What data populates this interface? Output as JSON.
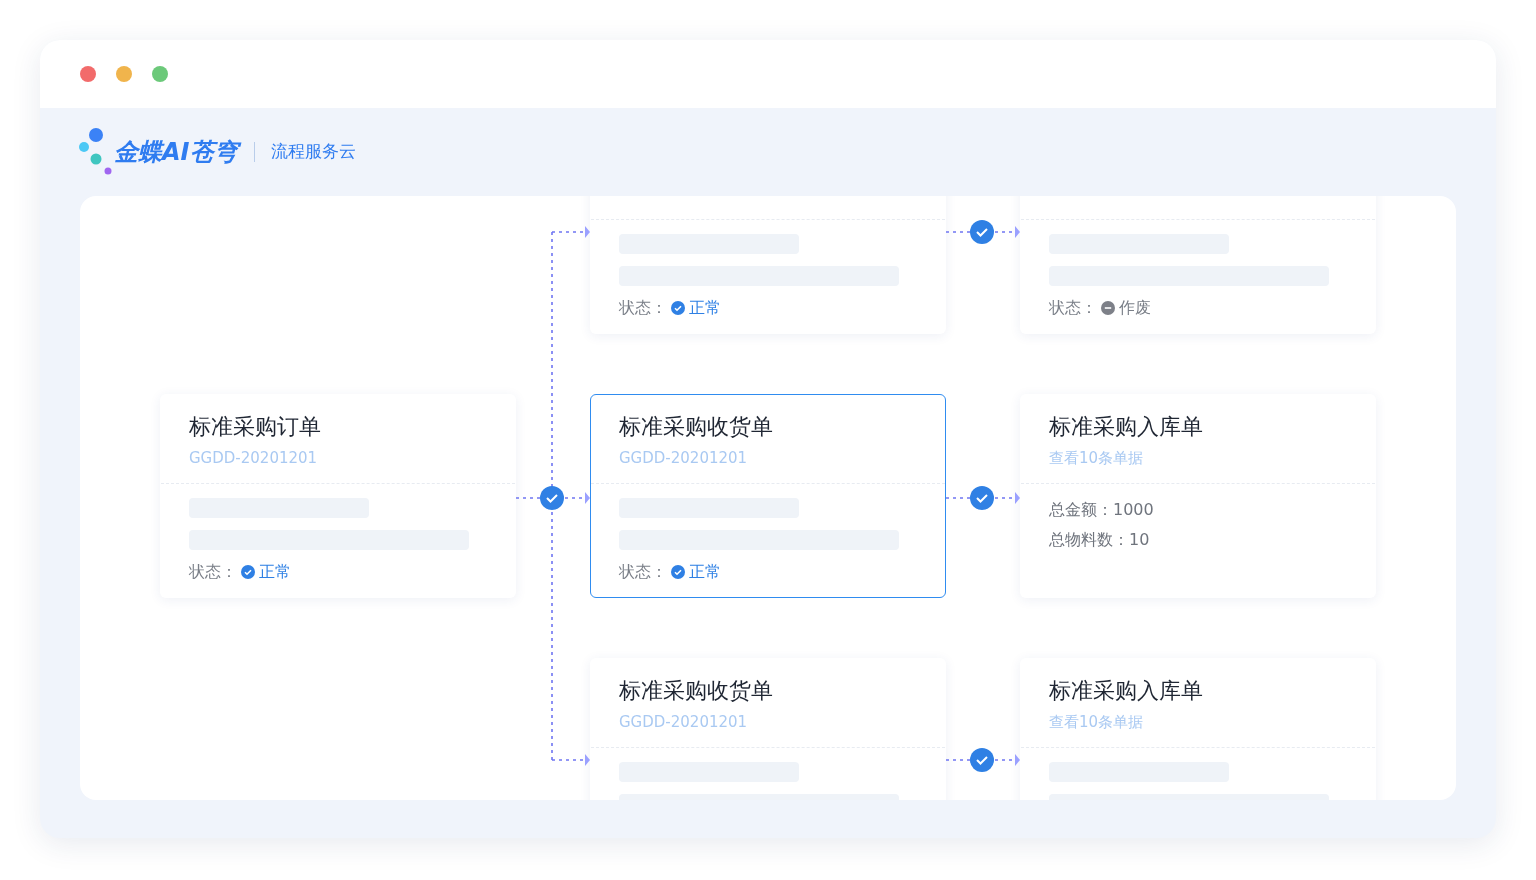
{
  "window": {
    "dots": [
      {
        "color": "#f26b6b"
      },
      {
        "color": "#f0b44c"
      },
      {
        "color": "#6cc97a"
      }
    ]
  },
  "header": {
    "logo_text": "金蝶AI苍穹",
    "product": "流程服务云"
  },
  "columns": [
    {
      "cards": [
        {
          "title": "标准采购订单",
          "subtitle": "GGDD-20201201",
          "selected": false,
          "body": {
            "kind": "status",
            "label": "状态：",
            "value": "正常",
            "voided": false
          }
        }
      ]
    },
    {
      "cards": [
        {
          "selected": false,
          "body": {
            "kind": "status",
            "label": "状态：",
            "value": "正常",
            "voided": false
          }
        },
        {
          "title": "标准采购收货单",
          "subtitle": "GGDD-20201201",
          "selected": true,
          "body": {
            "kind": "status",
            "label": "状态：",
            "value": "正常",
            "voided": false
          }
        },
        {
          "title": "标准采购收货单",
          "subtitle": "GGDD-20201201",
          "selected": false,
          "body": {
            "kind": "bars"
          }
        }
      ]
    },
    {
      "cards": [
        {
          "selected": false,
          "body": {
            "kind": "status",
            "label": "状态：",
            "value": "作废",
            "voided": true
          }
        },
        {
          "title": "标准采购入库单",
          "subtitle": "查看10条单据",
          "selected": false,
          "body": {
            "kind": "totals",
            "lines": [
              "总金额：1000",
              "总物料数：10"
            ]
          }
        },
        {
          "title": "标准采购入库单",
          "subtitle": "查看10条单据",
          "selected": false,
          "body": {
            "kind": "bars"
          }
        }
      ]
    }
  ]
}
